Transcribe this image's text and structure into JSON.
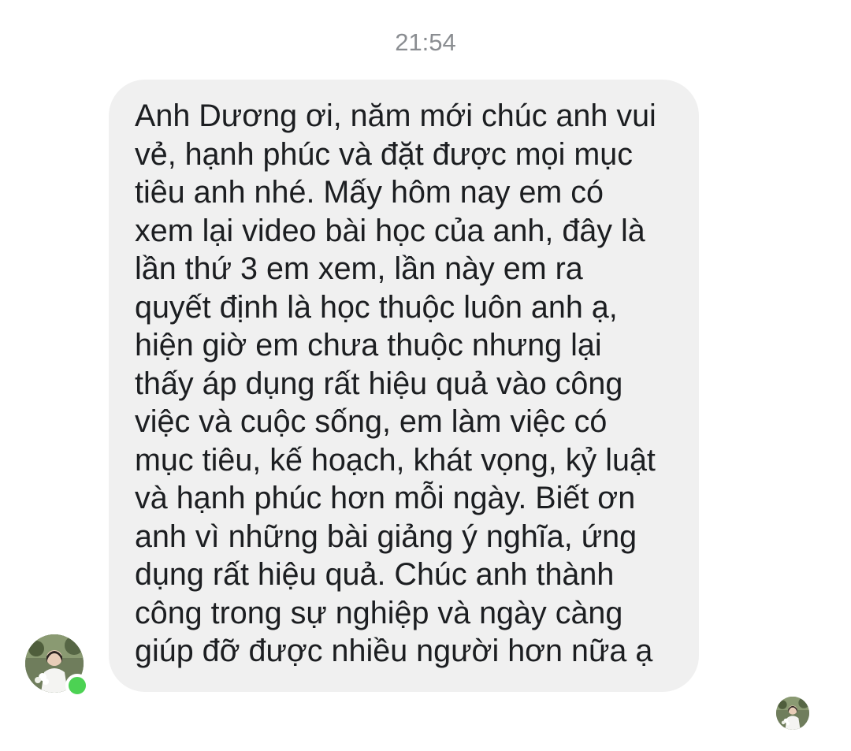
{
  "chat": {
    "timestamp": "21:54",
    "message": {
      "text": "Anh Dương ơi, năm mới chúc anh vui\nvẻ, hạnh phúc và đặt được mọi mục\ntiêu anh nhé. Mấy hôm nay em có\nxem lại video bài học của anh, đây là\nlần thứ 3 em xem, lần này em ra\nquyết định là học thuộc luôn anh ạ,\nhiện giờ em chưa thuộc nhưng lại\nthấy áp dụng rất hiệu quả vào công\nviệc và cuộc sống, em làm việc có\nmục tiêu, kế hoạch, khát vọng, kỷ luật\nvà hạnh phúc hơn mỗi ngày. Biết ơn\nanh vì những bài giảng ý nghĩa, ứng\ndụng rất hiệu quả. Chúc anh thành\ncông trong sự nghiệp và ngày càng\ngiúp đỡ được nhiều người hơn nữa ạ"
    },
    "sender": {
      "avatar_icon": "user-avatar-photo",
      "online_status_icon": "online-dot-icon",
      "online_color": "#4cd253"
    },
    "read_receipt": {
      "avatar_icon": "seen-avatar-photo"
    },
    "bubble_color": "#f0f0f0",
    "text_color": "#1c1e21"
  }
}
